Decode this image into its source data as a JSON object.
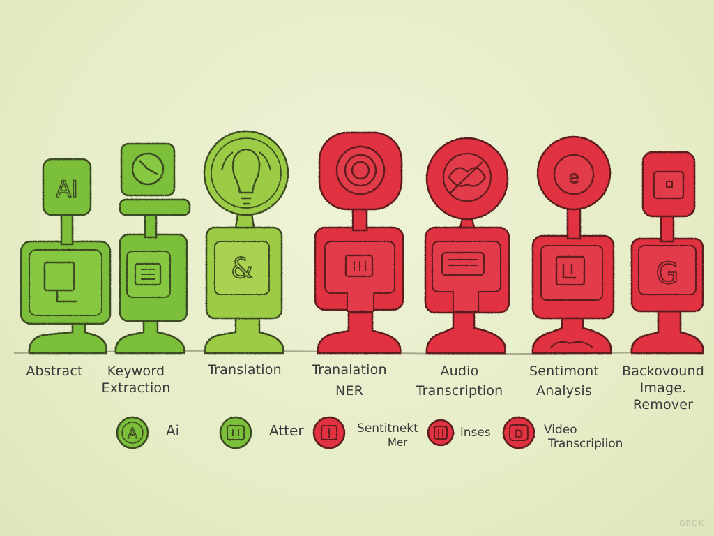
{
  "colors": {
    "green": "#7cbf3a",
    "green_light": "#9ccc45",
    "red": "#e0303f",
    "outline": "#3b4a22",
    "background": "#e8efcc"
  },
  "figures": [
    {
      "line1": "Abstract",
      "line2": "",
      "line3": "",
      "color": "green",
      "top_icon": "ai-text-icon",
      "bottom_icon": "document-icon"
    },
    {
      "line1": "Keyword",
      "line2": "Extraction",
      "line3": "",
      "color": "green",
      "top_icon": "clock-icon",
      "bottom_icon": "list-icon"
    },
    {
      "line1": "Translation",
      "line2": "",
      "line3": "",
      "color": "green_light",
      "top_icon": "lightbulb-icon",
      "bottom_icon": "ampersand-icon"
    },
    {
      "line1": "Tranalation",
      "line2": "NER",
      "line3": "",
      "color": "red",
      "top_icon": "target-icon",
      "bottom_icon": "grid-icon"
    },
    {
      "line1": "Audio",
      "line2": "Transcription",
      "line3": "",
      "color": "red",
      "top_icon": "lips-icon",
      "bottom_icon": "waveform-icon"
    },
    {
      "line1": "Sentimont",
      "line2": "Analysis",
      "line3": "",
      "color": "red",
      "top_icon": "emoticon-icon",
      "bottom_icon": "chart-icon"
    },
    {
      "line1": "Backovound",
      "line2": "Image.",
      "line3": "Remover",
      "color": "red",
      "top_icon": "image-icon",
      "bottom_icon": "g-icon"
    }
  ],
  "legend": [
    {
      "label": "Ai",
      "sub": "",
      "color": "green",
      "icon_char": "A"
    },
    {
      "label": "Atter",
      "sub": "",
      "color": "green",
      "icon_char": "◫"
    },
    {
      "label": "Sentitnekt",
      "sub": "Mer",
      "color": "red",
      "icon_char": "◫"
    },
    {
      "label": "inses",
      "sub": "",
      "color": "red",
      "icon_char": "▥"
    },
    {
      "label": "Video",
      "sub": "Transcripiion",
      "color": "red",
      "icon_char": "D"
    }
  ],
  "watermark": "GROK"
}
